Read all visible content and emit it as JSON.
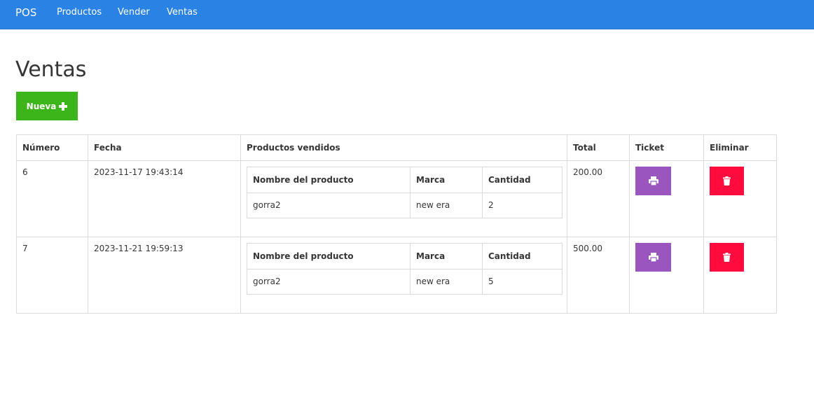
{
  "nav": {
    "brand": "POS",
    "links": [
      "Productos",
      "Vender",
      "Ventas"
    ]
  },
  "page": {
    "title": "Ventas",
    "new_button_label": "Nueva"
  },
  "colors": {
    "navbar": "#2a82e4",
    "new_button": "#3bb51a",
    "ticket_button": "#9a55be",
    "delete_button": "#ff0b3e"
  },
  "icons": {
    "new_button": "plus-icon",
    "ticket": "print-icon",
    "delete": "trash-icon"
  },
  "table": {
    "headers": [
      "Número",
      "Fecha",
      "Productos vendidos",
      "Total",
      "Ticket",
      "Eliminar"
    ],
    "product_headers": [
      "Nombre del producto",
      "Marca",
      "Cantidad"
    ],
    "rows": [
      {
        "numero": "6",
        "fecha": "2023-11-17 19:43:14",
        "productos": [
          {
            "nombre": "gorra2",
            "marca": "new era",
            "cantidad": "2"
          }
        ],
        "total": "200.00"
      },
      {
        "numero": "7",
        "fecha": "2023-11-21 19:59:13",
        "productos": [
          {
            "nombre": "gorra2",
            "marca": "new era",
            "cantidad": "5"
          }
        ],
        "total": "500.00"
      }
    ]
  }
}
